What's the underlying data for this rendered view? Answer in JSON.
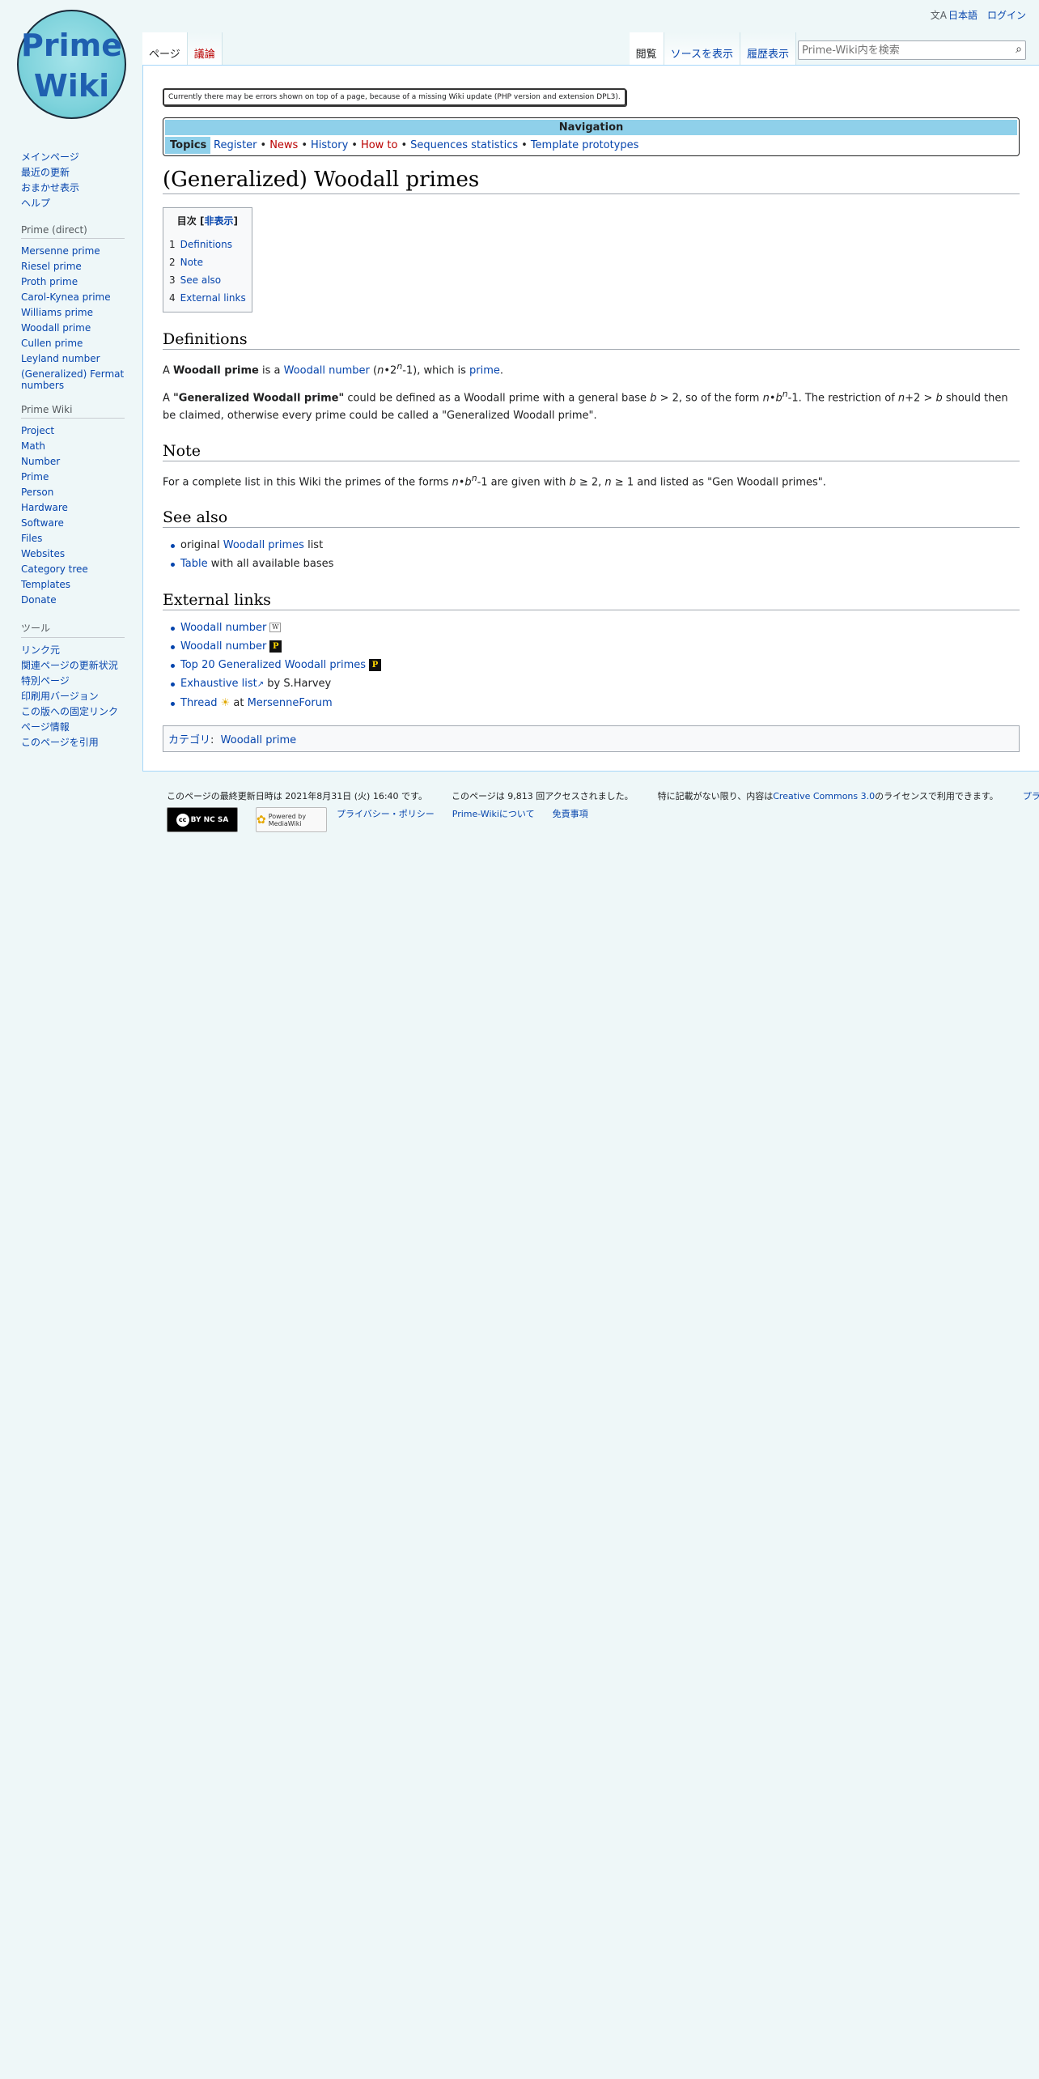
{
  "personal": {
    "language": "日本語",
    "login": "ログイン"
  },
  "logo": {
    "line1": "Prime",
    "line2": "Wiki"
  },
  "sidebar": {
    "main": [
      "メインページ",
      "最近の更新",
      "おまかせ表示",
      "ヘルプ"
    ],
    "prime_direct": {
      "heading": "Prime (direct)",
      "items": [
        "Mersenne prime",
        "Riesel prime",
        "Proth prime",
        "Carol-Kynea prime",
        "Williams prime",
        "Woodall prime",
        "Cullen prime",
        "Leyland number",
        "(Generalized) Fermat numbers"
      ]
    },
    "prime_wiki": {
      "heading": "Prime Wiki",
      "items": [
        "Project",
        "Math",
        "Number",
        "Prime",
        "Person",
        "Hardware",
        "Software",
        "Files",
        "Websites",
        "Category tree",
        "Templates",
        "Donate"
      ]
    },
    "tools": {
      "heading": "ツール",
      "items": [
        "リンク元",
        "関連ページの更新状況",
        "特別ページ",
        "印刷用バージョン",
        "この版への固定リンク",
        "ページ情報",
        "このページを引用"
      ]
    }
  },
  "tabs": {
    "page": "ページ",
    "talk": "議論",
    "read": "閲覧",
    "view_source": "ソースを表示",
    "history": "履歴表示"
  },
  "search": {
    "placeholder": "Prime-Wiki内を検索"
  },
  "notice": "Currently there may be errors shown on top of a page, because of a missing Wiki update (PHP version and extension DPL3).",
  "navbox": {
    "title": "Navigation",
    "group": "Topics",
    "links": [
      "Register",
      "News",
      "History",
      "How to",
      "Sequences statistics",
      "Template prototypes"
    ],
    "sep": "•"
  },
  "title": "(Generalized) Woodall primes",
  "toc": {
    "title": "目次",
    "toggle": "非表示",
    "items": [
      {
        "num": "1",
        "label": "Definitions"
      },
      {
        "num": "2",
        "label": "Note"
      },
      {
        "num": "3",
        "label": "See also"
      },
      {
        "num": "4",
        "label": "External links"
      }
    ]
  },
  "definitions": {
    "heading": "Definitions",
    "p1": {
      "a": "A ",
      "bold": "Woodall prime",
      "b": " is a ",
      "link1": "Woodall number",
      "c": " (",
      "n": "n",
      "dot": "•2",
      "sup": "n",
      "d": "-1), which is ",
      "link2": "prime",
      "e": "."
    },
    "p2": {
      "a": "A ",
      "bold": "\"Generalized Woodall prime\"",
      "b": " could be defined as a Woodall prime with a general base ",
      "b_var": "b",
      "c": " > 2, so of the form ",
      "n": "n",
      "dot": "•",
      "b2": "b",
      "sup": "n",
      "d": "-1. The restriction of ",
      "n2": "n",
      "e": "+2 > ",
      "b3": "b",
      "f": " should then be claimed, otherwise every prime could be called a \"Generalized Woodall prime\"."
    }
  },
  "note": {
    "heading": "Note",
    "p": {
      "a": "For a complete list in this Wiki the primes of the forms ",
      "n": "n",
      "dot": "•",
      "b": "b",
      "sup": "n",
      "c": "-1 are given with ",
      "b2": "b",
      "d": " ≥ 2, ",
      "n2": "n",
      "e": " ≥ 1 and listed as \"Gen Woodall primes\"."
    }
  },
  "see_also": {
    "heading": "See also",
    "items": [
      {
        "pre": "original ",
        "link": "Woodall primes",
        "post": " list"
      },
      {
        "pre": "",
        "link": "Table",
        "post": " with all available bases"
      }
    ]
  },
  "external": {
    "heading": "External links",
    "items": [
      {
        "link": "Woodall number",
        "badge": "W"
      },
      {
        "link": "Woodall number",
        "badge": "P"
      },
      {
        "link": "Top 20 Generalized Woodall primes",
        "badge": "P"
      },
      {
        "link": "Exhaustive list",
        "post": " by S.Harvey"
      },
      {
        "link": "Thread",
        "mid": " at ",
        "link2": "MersenneForum"
      }
    ]
  },
  "category": {
    "label": "カテゴリ",
    "colon": ":",
    "link": "Woodall prime"
  },
  "footer": {
    "lastmod": "このページの最終更新日時は 2021年8月31日 (火) 16:40 です。",
    "views": "このページは 9,813 回アクセスされました。",
    "license_pre": "特に記載がない限り、内容は",
    "license_link": "Creative Commons 3.0",
    "license_post": "のライセンスで利用できます。",
    "privacy_cut": "プライ",
    "places": [
      "プライバシー・ポリシー",
      "Prime-Wikiについて",
      "免責事項"
    ],
    "cc_text": "BY NC SA",
    "mw_text": "Powered by MediaWiki"
  },
  "colors": {
    "link": "#0645ad",
    "new_link": "#ba0000",
    "nav_header": "#8fd0ea",
    "page_bg": "#eef7f8"
  }
}
